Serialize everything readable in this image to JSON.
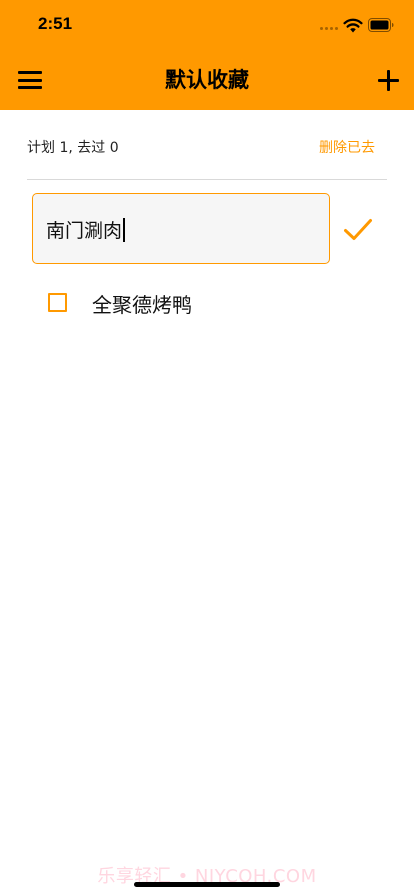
{
  "status_bar": {
    "time": "2:51"
  },
  "nav": {
    "title": "默认收藏"
  },
  "summary": {
    "text": "计划 1, 去过 0",
    "delete_done_label": "删除已去"
  },
  "edit": {
    "value": "南门涮肉"
  },
  "items": [
    {
      "label": "全聚德烤鸭",
      "checked": false
    }
  ],
  "watermark": {
    "text": "乐享轻汇 • NJYCOH.COM"
  },
  "colors": {
    "accent": "#FF9900",
    "background": "#FFFFFF",
    "text": "#111111"
  },
  "icons": [
    "signal-icon",
    "wifi-icon",
    "battery-icon",
    "menu-icon",
    "add-icon",
    "checkmark-icon",
    "checkbox-icon"
  ]
}
